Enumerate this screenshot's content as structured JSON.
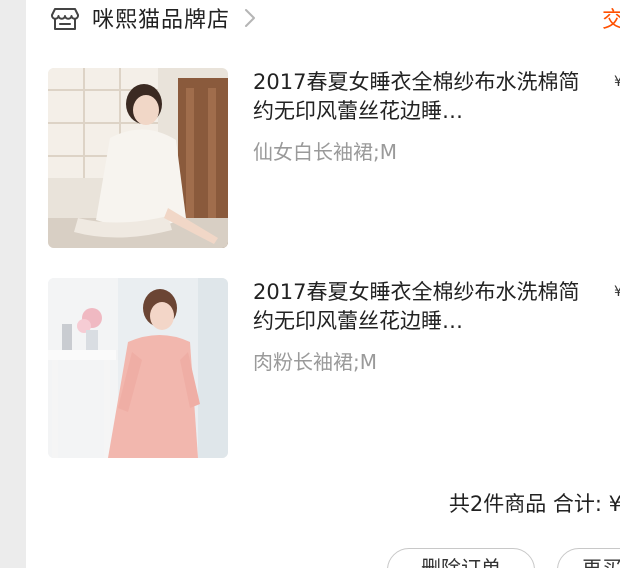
{
  "shop": {
    "name": "咪熙猫品牌店",
    "status": "交"
  },
  "items": [
    {
      "title": "2017春夏女睡衣全棉纱布水洗棉简约无印风蕾丝花边睡…",
      "sku": "仙女白长袖裙;M",
      "price_partial": "¥"
    },
    {
      "title": "2017春夏女睡衣全棉纱布水洗棉简约无印风蕾丝花边睡…",
      "sku": "肉粉长袖裙;M",
      "price_partial": "¥"
    }
  ],
  "summary": {
    "text": "共2件商品 合计: ¥"
  },
  "actions": {
    "delete_label": "删除订单",
    "more_label": "再买"
  },
  "colors": {
    "accent": "#ff5000",
    "sku_text": "#9a9a9a",
    "background": "#ececec"
  },
  "icons": {
    "shop": "shop-icon",
    "chevron": "chevron-right-icon"
  }
}
